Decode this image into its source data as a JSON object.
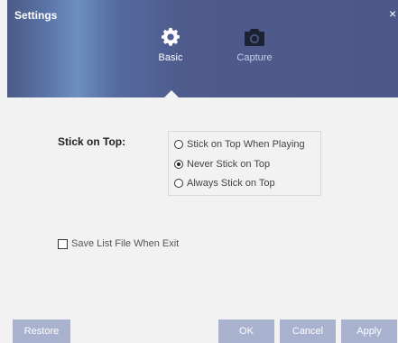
{
  "window": {
    "title": "Settings",
    "close_glyph": "×"
  },
  "tabs": [
    {
      "label": "Basic",
      "icon": "gear-icon",
      "active": true
    },
    {
      "label": "Capture",
      "icon": "camera-icon",
      "active": false
    }
  ],
  "basic": {
    "stick_label": "Stick on Top:",
    "options": [
      {
        "label": "Stick on Top When Playing",
        "checked": false
      },
      {
        "label": "Never Stick on Top",
        "checked": true
      },
      {
        "label": "Always Stick on Top",
        "checked": false
      }
    ],
    "save_list": {
      "label": "Save List File When Exit",
      "checked": false
    }
  },
  "buttons": {
    "restore": "Restore",
    "ok": "OK",
    "cancel": "Cancel",
    "apply": "Apply"
  },
  "colors": {
    "header": "#4e5b8c",
    "button": "#a8b2cf",
    "body": "#f2f2f2"
  }
}
